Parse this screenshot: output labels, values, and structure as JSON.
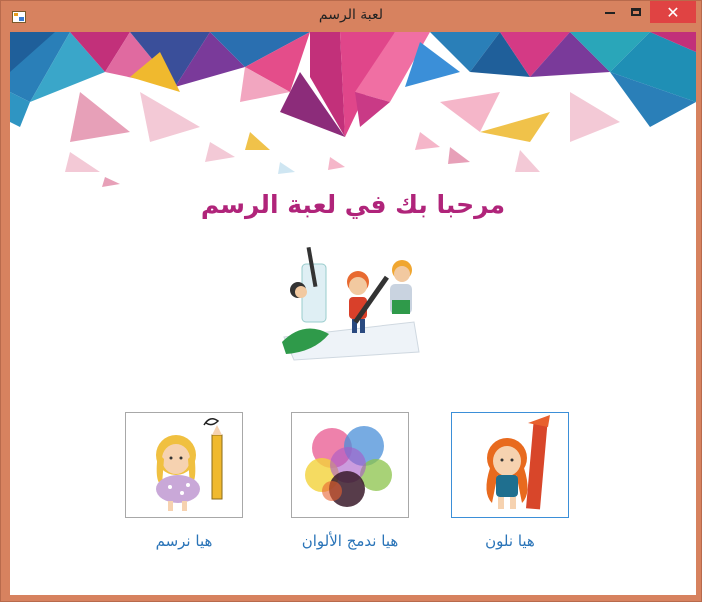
{
  "window": {
    "title": "لعبة الرسم",
    "close_glyph": "✕"
  },
  "main": {
    "heading": "مرحبا بك في لعبة الرسم",
    "options": [
      {
        "label": "هيا نلون",
        "icon": "girl-with-crayon-illustration"
      },
      {
        "label": "هيا ندمج الألوان",
        "icon": "color-blend-blobs"
      },
      {
        "label": "هيا نرسم",
        "icon": "girl-with-pencil-illustration"
      }
    ]
  },
  "colors": {
    "title_bar": "#d7825f",
    "heading": "#b0247a",
    "link": "#2a74b8",
    "close_button": "#e04343"
  }
}
